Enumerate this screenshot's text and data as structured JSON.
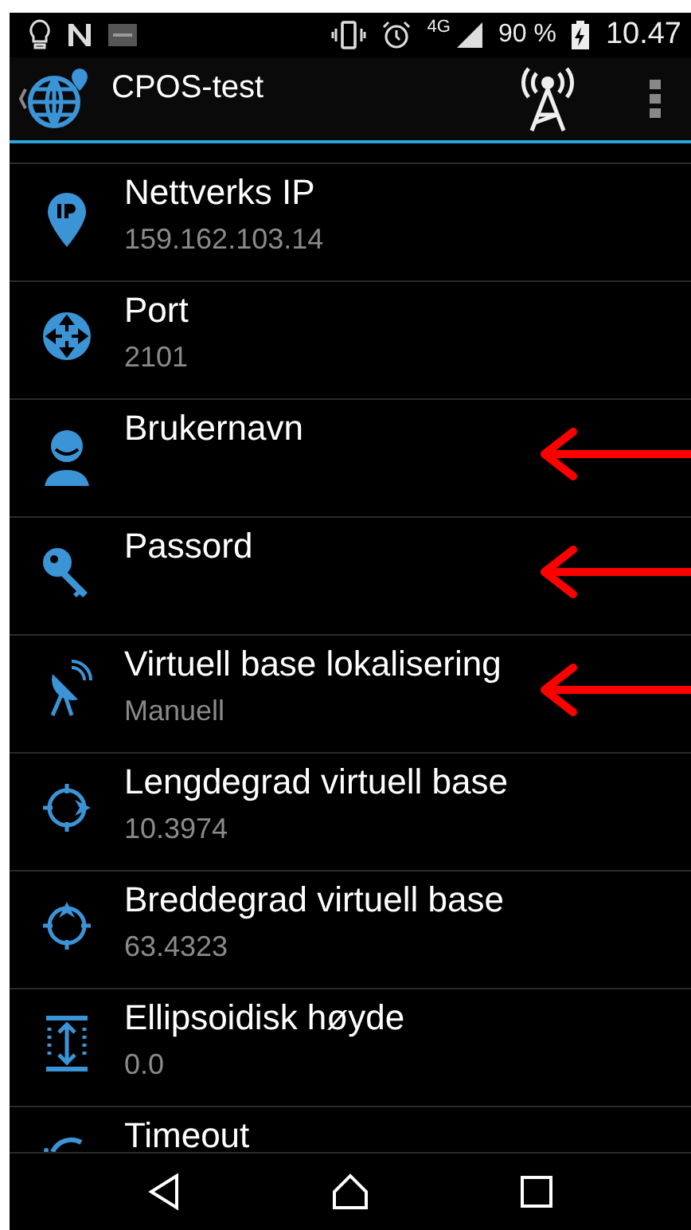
{
  "status_bar": {
    "network": "4G",
    "battery": "90 %",
    "time": "10.47"
  },
  "app_bar": {
    "title": "CPOS-test"
  },
  "settings": [
    {
      "kind": "ip",
      "title": "Nettverks IP",
      "value": "159.162.103.14",
      "annotated": false
    },
    {
      "kind": "port",
      "title": "Port",
      "value": "2101",
      "annotated": false
    },
    {
      "kind": "user",
      "title": "Brukernavn",
      "annotated": true
    },
    {
      "kind": "key",
      "title": "Passord",
      "annotated": true
    },
    {
      "kind": "dish",
      "title": "Virtuell base lokalisering",
      "value": "Manuell",
      "annotated": true
    },
    {
      "kind": "longitude",
      "title": "Lengdegrad virtuell base",
      "value": "10.3974",
      "annotated": false
    },
    {
      "kind": "latitude",
      "title": "Breddegrad virtuell base",
      "value": "63.4323",
      "annotated": false
    },
    {
      "kind": "height",
      "title": "Ellipsoidisk høyde",
      "value": "0.0",
      "annotated": false
    },
    {
      "kind": "timeout",
      "title": "Timeout",
      "annotated": false
    }
  ]
}
